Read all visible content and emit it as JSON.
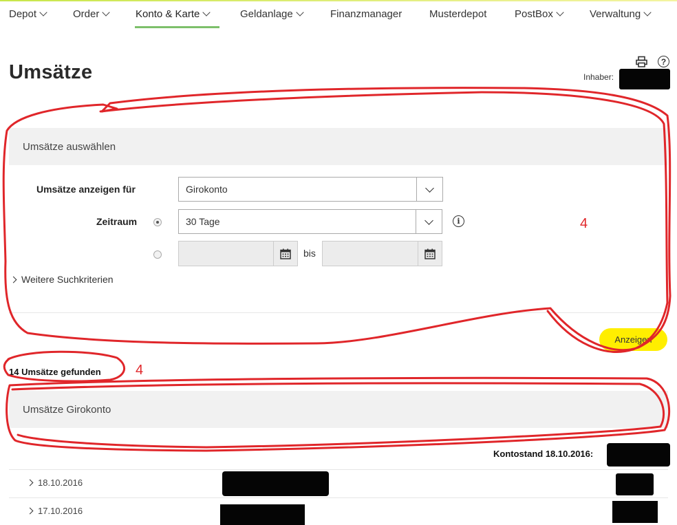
{
  "nav": {
    "items": [
      {
        "label": "Depot",
        "dropdown": true
      },
      {
        "label": "Order",
        "dropdown": true
      },
      {
        "label": "Konto & Karte",
        "dropdown": true,
        "active": true
      },
      {
        "label": "Geldanlage",
        "dropdown": true
      },
      {
        "label": "Finanzmanager",
        "dropdown": false
      },
      {
        "label": "Musterdepot",
        "dropdown": false
      },
      {
        "label": "PostBox",
        "dropdown": true
      },
      {
        "label": "Verwaltung",
        "dropdown": true
      }
    ]
  },
  "page": {
    "title": "Umsätze",
    "owner_label": "Inhaber:",
    "owner_value_visible": "S"
  },
  "filter": {
    "header": "Umsätze auswählen",
    "account_label": "Umsätze anzeigen für",
    "account_value": "Girokonto",
    "period_label": "Zeitraum",
    "period_value": "30 Tage",
    "period_radio_selected": "preset",
    "range_separator": "bis",
    "more_criteria": "Weitere Suchkriterien",
    "submit": "Anzeigen"
  },
  "results": {
    "count_text": "14 Umsätze gefunden",
    "section_title": "Umsätze Girokonto",
    "balance_label": "Kontostand 18.10.2016:",
    "rows": [
      {
        "date": "18.10.2016"
      },
      {
        "date": "17.10.2016"
      }
    ]
  },
  "annotations": {
    "label_1": "4",
    "label_2": "4",
    "color": "#e0262a"
  },
  "colors": {
    "accent_button": "#ffee00",
    "nav_active_underline": "#7cc06a",
    "panel_header_bg": "#f1f1f1"
  }
}
